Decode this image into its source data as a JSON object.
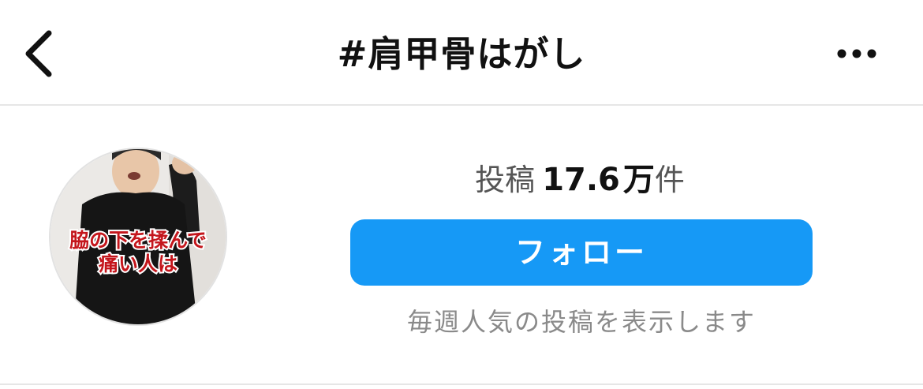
{
  "header": {
    "title": "#肩甲骨はがし",
    "back_icon": "chevron-left-icon",
    "more_icon": "more-horizontal-icon"
  },
  "avatar": {
    "overlay_text_line1": "脇の下を揉んで",
    "overlay_text_line2": "痛い人は"
  },
  "stats": {
    "posts_label": "投稿",
    "posts_number": "17.6",
    "posts_unit_big": "万",
    "posts_unit": "件"
  },
  "follow_label": "フォロー",
  "caption": "毎週人気の投稿を表示します",
  "colors": {
    "accent": "#1699f6",
    "divider": "#e6e6e6",
    "caption": "#8a8a8a"
  }
}
